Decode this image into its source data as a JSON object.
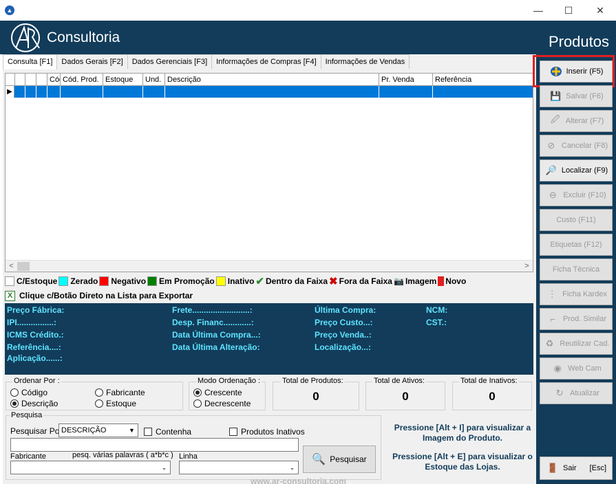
{
  "window": {
    "minimize": "—",
    "maximize": "☐",
    "close": "✕"
  },
  "header": {
    "logo_text": "Consultoria",
    "page_title": "Produtos"
  },
  "tabs": [
    {
      "label": "Consulta [F1]"
    },
    {
      "label": "Dados Gerais [F2]"
    },
    {
      "label": "Dados Gerenciais [F3]"
    },
    {
      "label": "Informações de Compras [F4]"
    },
    {
      "label": "Informações de Vendas"
    }
  ],
  "grid": {
    "columns": [
      "",
      "",
      "",
      "",
      "Cód. Prod.",
      "Estoque",
      "Und.",
      "Descrição",
      "Pr. Venda",
      "Referência"
    ],
    "row_indicator": "▶",
    "scroll_left": "<",
    "scroll_right": ">"
  },
  "legend": [
    {
      "label": "C/Estoque",
      "color": "#ffffff"
    },
    {
      "label": "Zerado",
      "color": "#00ffff"
    },
    {
      "label": "Negativo",
      "color": "#ff0000"
    },
    {
      "label": "Em Promoção",
      "color": "#008000"
    },
    {
      "label": "Inativo",
      "color": "#ffff00"
    },
    {
      "label": "Dentro da Faixa",
      "icon": "check-icon"
    },
    {
      "label": "Fora da Faixa",
      "icon": "x-icon"
    },
    {
      "label": "Imagem",
      "icon": "camera-icon"
    },
    {
      "label": "Novo",
      "icon": "new-icon"
    }
  ],
  "export_text": "Clique c/Botão Direto na Lista para Exportar",
  "info": {
    "preco_fabrica": "Preço Fábrica:",
    "ipi": "IPI................:",
    "icms": "ICMS Crédito.:",
    "referencia": "Referência....:",
    "aplicacao": "Aplicação......:",
    "frete": "Frete.........................:",
    "desp": "Desp. Financ............:",
    "data_compra": "Data Última Compra...:",
    "data_alteracao": "Data Última Alteração:",
    "ultima_compra": "Última Compra:",
    "preco_custo": "Preço Custo...:",
    "preco_venda": "Preço Venda..:",
    "localizacao": "Localização...:",
    "ncm": "NCM:",
    "cst": "CST.:"
  },
  "ordenar": {
    "title": "Ordenar Por :",
    "options": [
      "Código",
      "Fabricante",
      "Descrição",
      "Estoque"
    ],
    "selected": "Descrição"
  },
  "modo": {
    "title": "Modo Ordenação :",
    "options": [
      "Crescente",
      "Decrescente"
    ],
    "selected": "Crescente"
  },
  "totals": [
    {
      "label": "Total de Produtos:",
      "value": "0"
    },
    {
      "label": "Total de Ativos:",
      "value": "0"
    },
    {
      "label": "Total de Inativos:",
      "value": "0"
    }
  ],
  "pesquisa": {
    "title": "Pesquisa",
    "por_label": "Pesquisar Por:",
    "por_value": "DESCRIÇÃO",
    "contenha": "Contenha",
    "inativos": "Produtos Inativos",
    "search_value": "",
    "fabricante_label": "Fabricante",
    "palavras_label": "pesq. várias palavras ( a*b*c )",
    "linha_label": "Linha",
    "button": "Pesquisar"
  },
  "hints": [
    "Pressione [Alt + I] para visualizar a Imagem do Produto.",
    "Pressione [Alt + E] para visualizar o Estoque das Lojas."
  ],
  "actions": [
    {
      "label": "Inserir (F5)",
      "enabled": true,
      "icon": "plus-icon"
    },
    {
      "label": "Salvar (F6)",
      "enabled": false,
      "icon": "save-icon"
    },
    {
      "label": "Alterar (F7)",
      "enabled": false,
      "icon": "edit-icon"
    },
    {
      "label": "Cancelar (F8)",
      "enabled": false,
      "icon": "cancel-icon"
    },
    {
      "label": "Localizar (F9)",
      "enabled": true,
      "icon": "search-icon"
    },
    {
      "label": "Excluir (F10)",
      "enabled": false,
      "icon": "delete-icon"
    },
    {
      "label": "Custo (F11)",
      "enabled": false,
      "icon": ""
    },
    {
      "label": "Etiquetas (F12)",
      "enabled": false,
      "icon": ""
    },
    {
      "label": "Ficha Técnica",
      "enabled": false,
      "icon": ""
    },
    {
      "label": "Ficha Kardex",
      "enabled": false,
      "icon": "kardex-icon"
    },
    {
      "label": "Prod. Similar",
      "enabled": false,
      "icon": "similar-icon"
    },
    {
      "label": "Reutilizar Cad.",
      "enabled": false,
      "icon": "recycle-icon"
    },
    {
      "label": "Web Cam",
      "enabled": false,
      "icon": "webcam-icon"
    },
    {
      "label": "Atualizar",
      "enabled": false,
      "icon": "refresh-icon"
    }
  ],
  "exit": {
    "label": "Sair",
    "shortcut": "[Esc]"
  },
  "watermark": "www.ar-consultoria.com"
}
